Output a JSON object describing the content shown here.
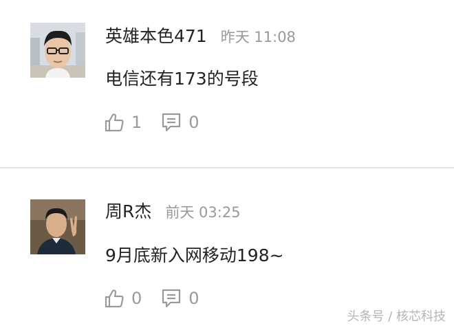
{
  "comments": [
    {
      "username": "英雄本色471",
      "timestamp": "昨天 11:08",
      "text": "电信还有173的号段",
      "like_count": "1",
      "reply_count": "0",
      "avatar_icon": "avatar-young-man-glasses"
    },
    {
      "username": "周R杰",
      "timestamp": "前天 03:25",
      "text": "9月底新入网移动198~",
      "like_count": "0",
      "reply_count": "0",
      "avatar_icon": "avatar-man-peace-sign"
    }
  ],
  "icons": {
    "like": "thumbs-up-icon",
    "reply": "comment-icon"
  },
  "watermark": "头条号 / 核芯科技",
  "colors": {
    "text": "#222222",
    "muted": "#999999",
    "divider": "#e6e6e6",
    "watermark": "#b5b5b5"
  }
}
